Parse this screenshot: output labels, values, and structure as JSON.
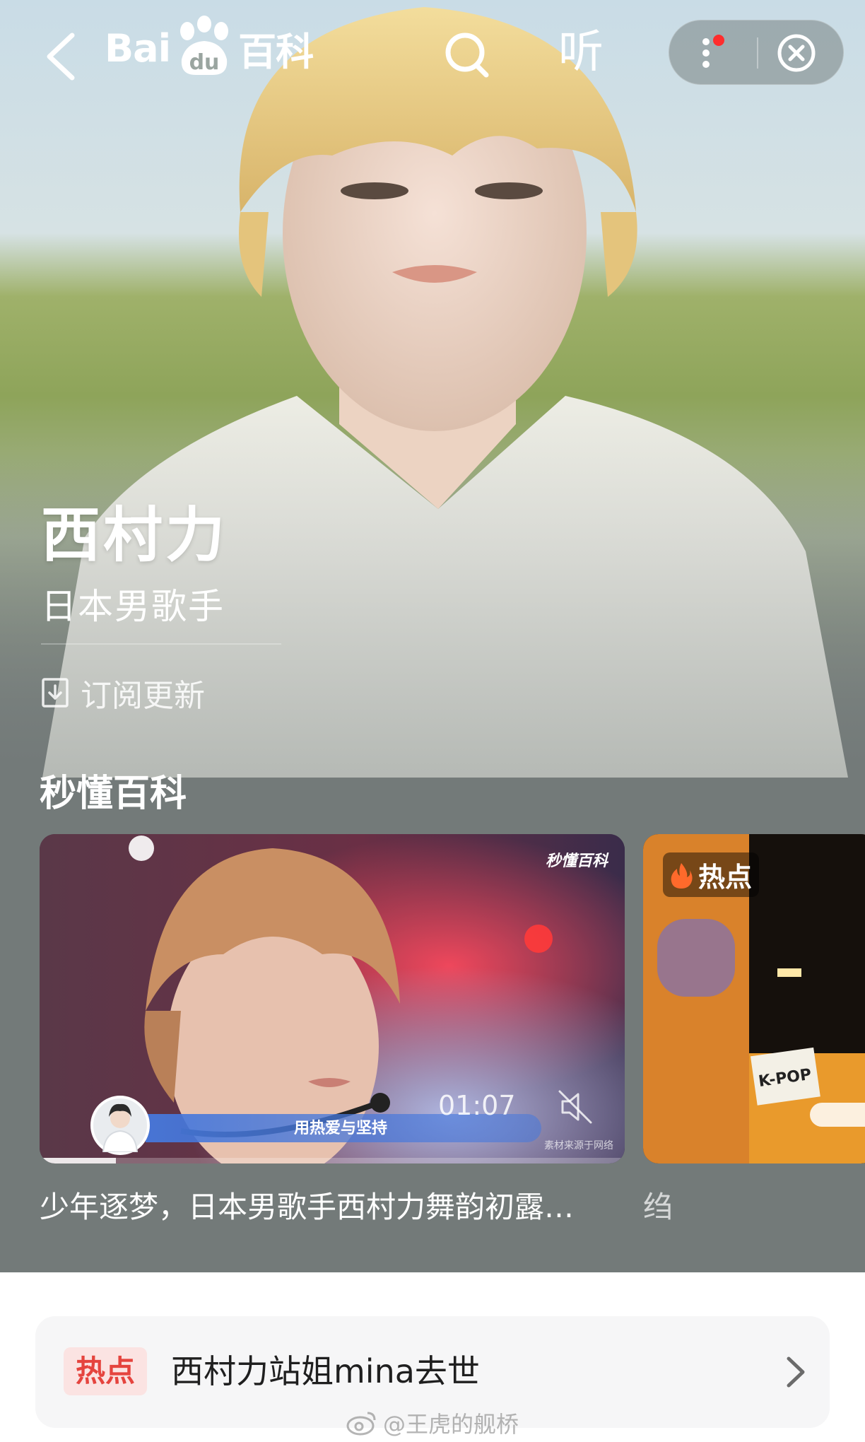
{
  "nav": {
    "logo_text_left": "Bai",
    "logo_paw_text": "du",
    "logo_text_right": "百科",
    "listen_label": "听"
  },
  "entry": {
    "title": "西村力",
    "subtitle": "日本男歌手",
    "subscribe_label": "订阅更新"
  },
  "section": {
    "title": "秒懂百科",
    "videos": [
      {
        "brand": "秒懂百科",
        "caption": "用热爱与坚持",
        "duration": "01:07",
        "source_note": "素材来源于网络",
        "title": "少年逐梦，日本男歌手西村力舞韵初露…",
        "progress": 0.13
      },
      {
        "tag": "热点",
        "sign_text": "K-POP",
        "title": "绉"
      }
    ]
  },
  "hot": {
    "badge": "热点",
    "text": "西村力站姐mina去世"
  },
  "watermark": "@王虎的舰桥",
  "colors": {
    "hot_red": "#e5443e",
    "hot_badge_bg": "#fbe3e2",
    "notification_dot": "#ff2d2d"
  },
  "icons": [
    "back-icon",
    "search-icon",
    "more-icon",
    "close-icon",
    "subscribe-icon",
    "mute-icon",
    "flame-icon",
    "chevron-right-icon",
    "weibo-icon"
  ]
}
